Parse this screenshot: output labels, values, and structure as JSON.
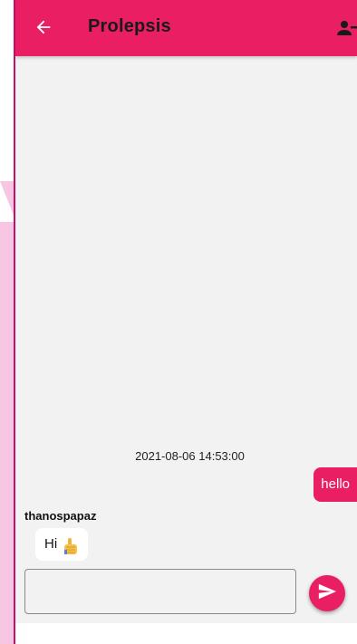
{
  "colors": {
    "accent": "#e91e63",
    "background": "#f2f2f2"
  },
  "appbar": {
    "title": "Prolepsis",
    "back_icon": "arrow-left-icon",
    "action_icon": "user-remove-icon"
  },
  "chat": {
    "timestamp": "2021-08-06 14:53:00",
    "messages": [
      {
        "direction": "outgoing",
        "text": "hello"
      },
      {
        "direction": "incoming",
        "sender": "thanospapaz",
        "text": "Hi",
        "emoji_icon": "thumbs-up-icon"
      }
    ]
  },
  "composer": {
    "value": "",
    "placeholder": "",
    "send_icon": "send-icon"
  }
}
